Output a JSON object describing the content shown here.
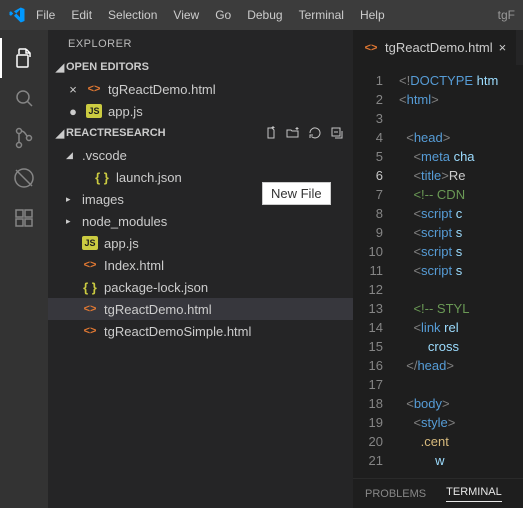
{
  "titlebar": {
    "menu": [
      "File",
      "Edit",
      "Selection",
      "View",
      "Go",
      "Debug",
      "Terminal",
      "Help"
    ],
    "right": "tgF"
  },
  "activitybar": {
    "active": 0
  },
  "explorer": {
    "title": "EXPLORER",
    "openEditors": {
      "title": "OPEN EDITORS",
      "items": [
        {
          "dirty": "×",
          "icon": "html",
          "label": "tgReactDemo.html"
        },
        {
          "dirty": "●",
          "icon": "js",
          "label": "app.js"
        }
      ]
    },
    "folder": {
      "title": "REACTRESEARCH",
      "items": [
        {
          "type": "folder",
          "expanded": true,
          "label": ".vscode"
        },
        {
          "type": "file",
          "indent": 1,
          "icon": "json",
          "label": "launch.json"
        },
        {
          "type": "folder",
          "expanded": false,
          "label": "images"
        },
        {
          "type": "folder",
          "expanded": false,
          "label": "node_modules"
        },
        {
          "type": "file",
          "icon": "js",
          "label": "app.js"
        },
        {
          "type": "file",
          "icon": "html",
          "label": "Index.html"
        },
        {
          "type": "file",
          "icon": "json",
          "label": "package-lock.json"
        },
        {
          "type": "file",
          "icon": "html",
          "label": "tgReactDemo.html",
          "selected": true
        },
        {
          "type": "file",
          "icon": "html",
          "label": "tgReactDemoSimple.html"
        }
      ]
    }
  },
  "tooltip": "New File",
  "editor": {
    "tab": {
      "icon": "html",
      "label": "tgReactDemo.html",
      "dirty": false
    },
    "currentLine": 6,
    "lines": [
      [
        [
          "gray",
          "<!"
        ],
        [
          "blue",
          "DOCTYPE"
        ],
        [
          "attr",
          " htm"
        ]
      ],
      [
        [
          "gray",
          "<"
        ],
        [
          "blue",
          "html"
        ],
        [
          "gray",
          ">"
        ]
      ],
      [],
      [
        [
          "gray",
          "  <"
        ],
        [
          "blue",
          "head"
        ],
        [
          "gray",
          ">"
        ]
      ],
      [
        [
          "gray",
          "    <"
        ],
        [
          "blue",
          "meta"
        ],
        [
          "attr",
          " cha"
        ]
      ],
      [
        [
          "gray",
          "    <"
        ],
        [
          "blue",
          "title"
        ],
        [
          "gray",
          ">"
        ],
        [
          "",
          "Re"
        ]
      ],
      [
        [
          "green",
          "    <!-- CDN "
        ]
      ],
      [
        [
          "gray",
          "    <"
        ],
        [
          "blue",
          "script"
        ],
        [
          "attr",
          " c"
        ]
      ],
      [
        [
          "gray",
          "    <"
        ],
        [
          "blue",
          "script"
        ],
        [
          "attr",
          " s"
        ]
      ],
      [
        [
          "gray",
          "    <"
        ],
        [
          "blue",
          "script"
        ],
        [
          "attr",
          " s"
        ]
      ],
      [
        [
          "gray",
          "    <"
        ],
        [
          "blue",
          "script"
        ],
        [
          "attr",
          " s"
        ]
      ],
      [],
      [
        [
          "green",
          "    <!-- STYL"
        ]
      ],
      [
        [
          "gray",
          "    <"
        ],
        [
          "blue",
          "link"
        ],
        [
          "attr",
          " rel"
        ]
      ],
      [
        [
          "attr",
          "        cross"
        ]
      ],
      [
        [
          "gray",
          "  </"
        ],
        [
          "blue",
          "head"
        ],
        [
          "gray",
          ">"
        ]
      ],
      [],
      [
        [
          "gray",
          "  <"
        ],
        [
          "blue",
          "body"
        ],
        [
          "gray",
          ">"
        ]
      ],
      [
        [
          "gray",
          "    <"
        ],
        [
          "blue",
          "style"
        ],
        [
          "gray",
          ">"
        ]
      ],
      [
        [
          "yel",
          "      .cent"
        ]
      ],
      [
        [
          "attr",
          "          w"
        ]
      ]
    ]
  },
  "panels": {
    "items": [
      "PROBLEMS",
      "TERMINAL"
    ],
    "active": 1
  }
}
